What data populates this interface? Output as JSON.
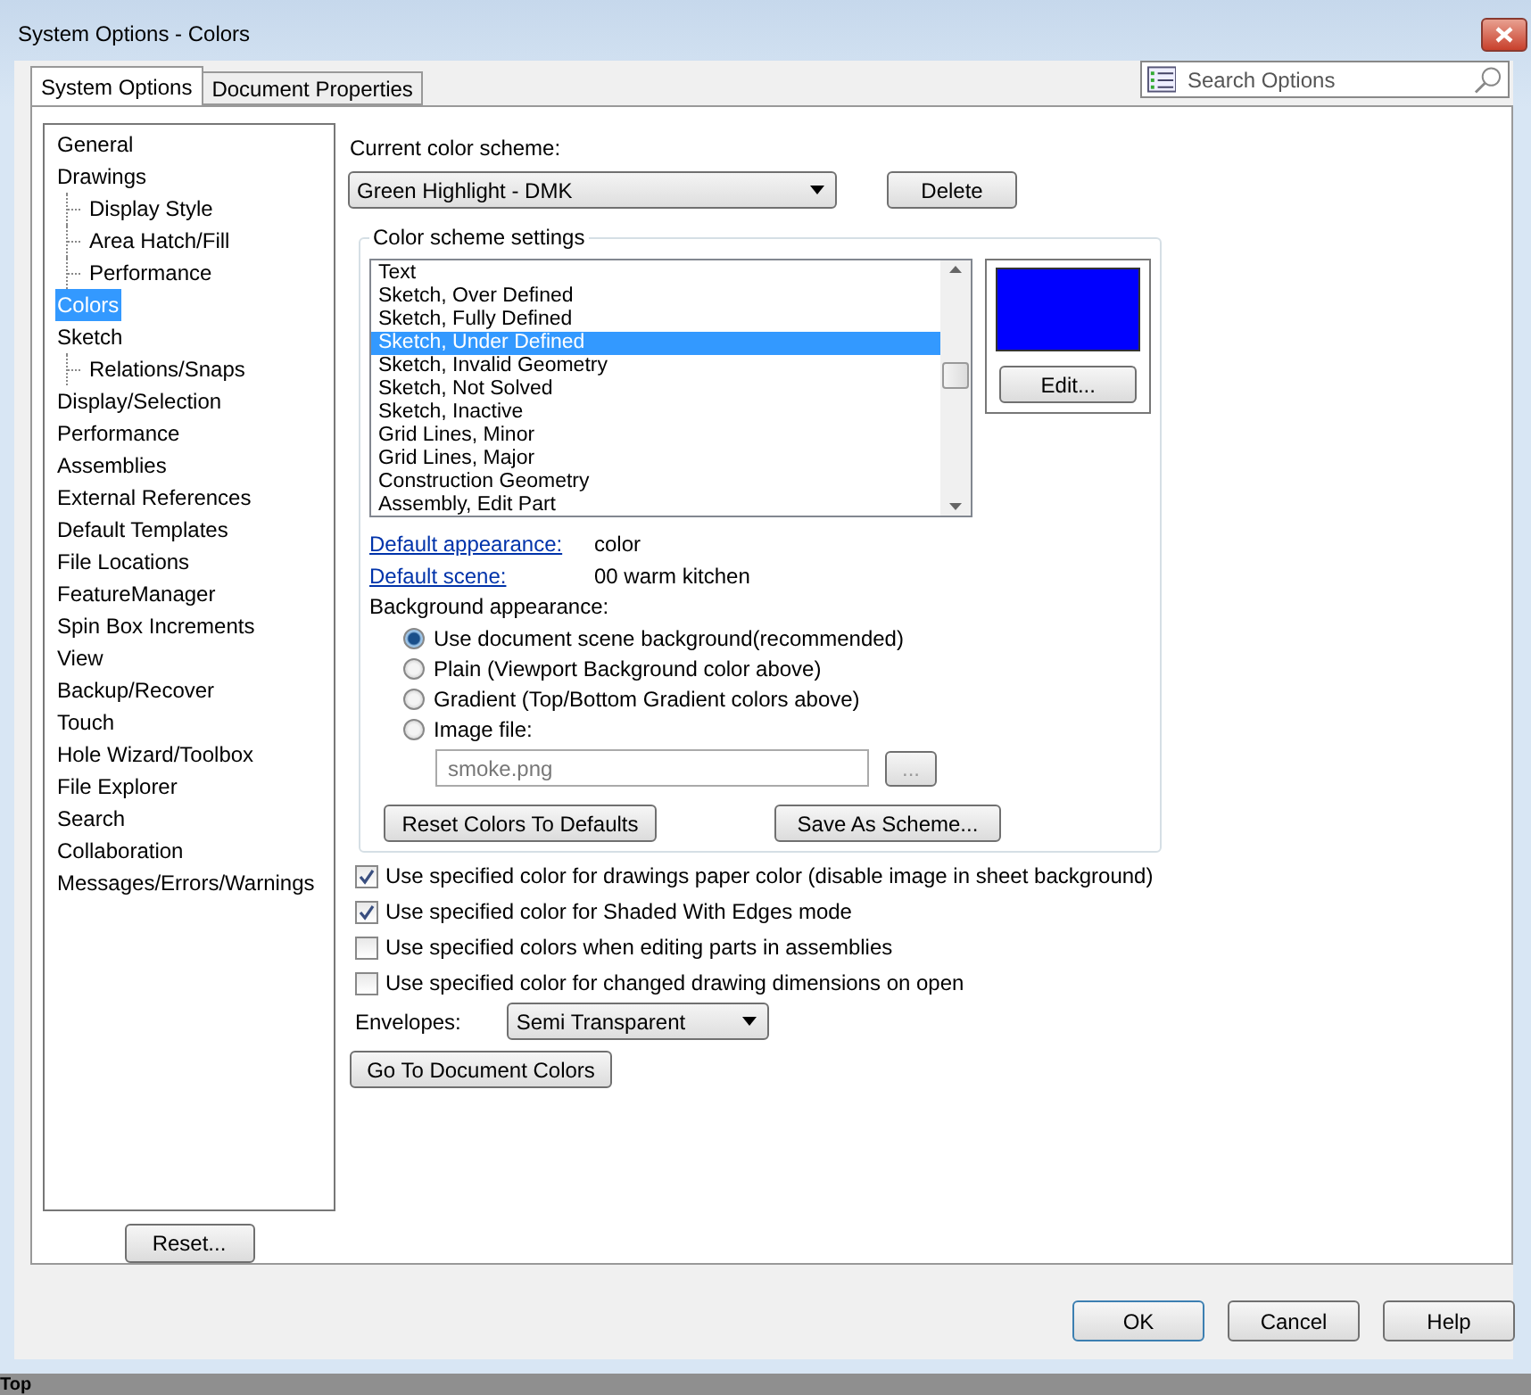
{
  "window": {
    "title": "System Options - Colors"
  },
  "tabs": [
    {
      "label": "System Options",
      "selected": true
    },
    {
      "label": "Document Properties",
      "selected": false
    }
  ],
  "search": {
    "placeholder": "Search Options"
  },
  "sidebar": {
    "items": [
      {
        "label": "General",
        "selected": false
      },
      {
        "label": "Drawings",
        "selected": false,
        "children": [
          {
            "label": "Display Style",
            "selected": false
          },
          {
            "label": "Area Hatch/Fill",
            "selected": false
          },
          {
            "label": "Performance",
            "selected": false
          }
        ]
      },
      {
        "label": "Colors",
        "selected": true
      },
      {
        "label": "Sketch",
        "selected": false,
        "children": [
          {
            "label": "Relations/Snaps",
            "selected": false
          }
        ]
      },
      {
        "label": "Display/Selection",
        "selected": false
      },
      {
        "label": "Performance",
        "selected": false
      },
      {
        "label": "Assemblies",
        "selected": false
      },
      {
        "label": "External References",
        "selected": false
      },
      {
        "label": "Default Templates",
        "selected": false
      },
      {
        "label": "File Locations",
        "selected": false
      },
      {
        "label": "FeatureManager",
        "selected": false
      },
      {
        "label": "Spin Box Increments",
        "selected": false
      },
      {
        "label": "View",
        "selected": false
      },
      {
        "label": "Backup/Recover",
        "selected": false
      },
      {
        "label": "Touch",
        "selected": false
      },
      {
        "label": "Hole Wizard/Toolbox",
        "selected": false
      },
      {
        "label": "File Explorer",
        "selected": false
      },
      {
        "label": "Search",
        "selected": false
      },
      {
        "label": "Collaboration",
        "selected": false
      },
      {
        "label": "Messages/Errors/Warnings",
        "selected": false
      }
    ],
    "reset_button": "Reset..."
  },
  "scheme": {
    "label": "Current color scheme:",
    "value": "Green Highlight - DMK",
    "delete_button": "Delete"
  },
  "settings": {
    "title": "Color scheme settings",
    "items": [
      {
        "label": "Text",
        "selected": false
      },
      {
        "label": "Sketch, Over Defined",
        "selected": false
      },
      {
        "label": "Sketch, Fully Defined",
        "selected": false
      },
      {
        "label": "Sketch, Under Defined",
        "selected": true
      },
      {
        "label": "Sketch, Invalid Geometry",
        "selected": false
      },
      {
        "label": "Sketch, Not Solved",
        "selected": false
      },
      {
        "label": "Sketch, Inactive",
        "selected": false
      },
      {
        "label": "Grid Lines, Minor",
        "selected": false
      },
      {
        "label": "Grid Lines, Major",
        "selected": false
      },
      {
        "label": "Construction Geometry",
        "selected": false
      },
      {
        "label": "Assembly, Edit Part",
        "selected": false
      }
    ],
    "swatch": {
      "color": "#0000ff"
    },
    "edit_button": "Edit...",
    "links": [
      {
        "label": "Default appearance:",
        "value": "color"
      },
      {
        "label": "Default scene:",
        "value": "00 warm kitchen"
      }
    ],
    "background_label": "Background appearance:",
    "background_options": [
      {
        "label": "Use document scene background(recommended)",
        "selected": true
      },
      {
        "label": "Plain (Viewport Background color above)",
        "selected": false
      },
      {
        "label": "Gradient (Top/Bottom Gradient colors above)",
        "selected": false
      },
      {
        "label": "Image file:",
        "selected": false
      }
    ],
    "image_file": {
      "value": "smoke.png",
      "disabled": true,
      "browse_button": "..."
    },
    "reset_button": "Reset Colors To Defaults",
    "save_button": "Save As Scheme..."
  },
  "options": [
    {
      "label": "Use specified color for drawings paper color (disable image in sheet background)",
      "checked": true
    },
    {
      "label": "Use specified color for Shaded With Edges mode",
      "checked": true
    },
    {
      "label": "Use specified colors when editing parts in assemblies",
      "checked": false
    },
    {
      "label": "Use specified color for changed drawing dimensions on open",
      "checked": false
    }
  ],
  "envelopes": {
    "label": "Envelopes:",
    "value": "Semi Transparent"
  },
  "go_button": "Go To Document Colors",
  "buttons": [
    {
      "label": "OK",
      "default": true
    },
    {
      "label": "Cancel",
      "default": false
    },
    {
      "label": "Help",
      "default": false
    }
  ],
  "status_bar": {
    "text": "Top"
  }
}
